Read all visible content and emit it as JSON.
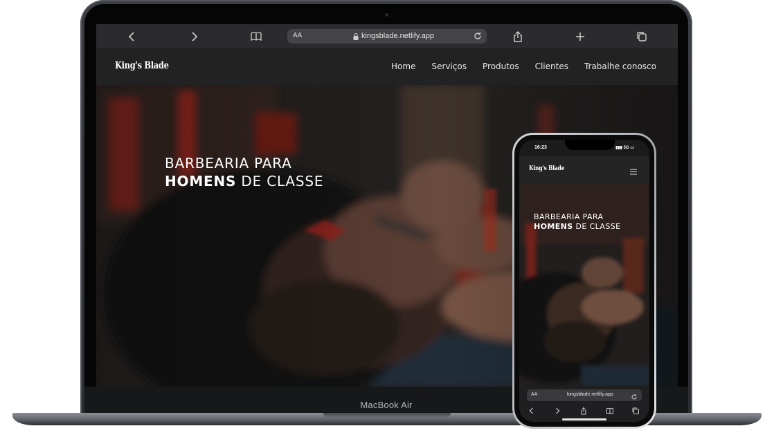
{
  "browser": {
    "text_size_label": "AA",
    "url": "kingsblade.netlify.app"
  },
  "site": {
    "logo": "King's Blade",
    "nav": [
      "Home",
      "Serviços",
      "Produtos",
      "Clientes",
      "Trabalhe conosco"
    ],
    "hero_line1": "BARBEARIA PARA",
    "hero_strong": "HOMENS",
    "hero_rest": " DE CLASSE"
  },
  "laptop": {
    "model_label": "MacBook Air"
  },
  "phone": {
    "time": "16:23",
    "network": "5G",
    "url": "kingsblade.netlify.app",
    "text_size_label": "AA"
  },
  "icons": {
    "back": "chevron-left-icon",
    "forward": "chevron-right-icon",
    "bookmarks": "book-icon",
    "lock": "lock-icon",
    "reload": "reload-icon",
    "share": "share-icon",
    "new_tab": "plus-icon",
    "tabs": "tabs-icon",
    "menu": "hamburger-menu-icon"
  },
  "colors": {
    "nav_bg": "#222222",
    "toolbar_bg": "#2b2b2d",
    "accent_red": "#b3261e"
  }
}
